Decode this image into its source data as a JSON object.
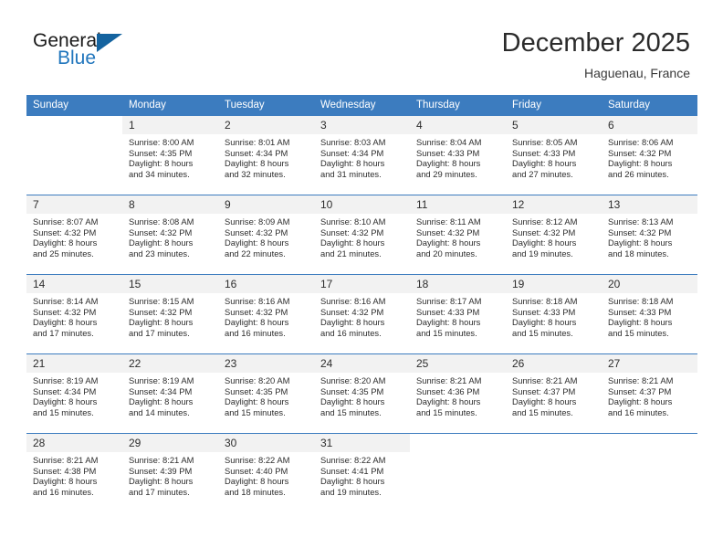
{
  "brand": {
    "name_part1": "General",
    "name_part2": "Blue",
    "logo_icon": "triangle-logo-icon"
  },
  "header": {
    "month_title": "December 2025",
    "location": "Haguenau, France",
    "accent_color": "#3c7cbf",
    "brand_blue": "#2176bd"
  },
  "calendar": {
    "weekday_headers": [
      "Sunday",
      "Monday",
      "Tuesday",
      "Wednesday",
      "Thursday",
      "Friday",
      "Saturday"
    ],
    "weeks": [
      [
        {
          "blank": true
        },
        {
          "day": "1",
          "sunrise": "Sunrise: 8:00 AM",
          "sunset": "Sunset: 4:35 PM",
          "daylight1": "Daylight: 8 hours",
          "daylight2": "and 34 minutes."
        },
        {
          "day": "2",
          "sunrise": "Sunrise: 8:01 AM",
          "sunset": "Sunset: 4:34 PM",
          "daylight1": "Daylight: 8 hours",
          "daylight2": "and 32 minutes."
        },
        {
          "day": "3",
          "sunrise": "Sunrise: 8:03 AM",
          "sunset": "Sunset: 4:34 PM",
          "daylight1": "Daylight: 8 hours",
          "daylight2": "and 31 minutes."
        },
        {
          "day": "4",
          "sunrise": "Sunrise: 8:04 AM",
          "sunset": "Sunset: 4:33 PM",
          "daylight1": "Daylight: 8 hours",
          "daylight2": "and 29 minutes."
        },
        {
          "day": "5",
          "sunrise": "Sunrise: 8:05 AM",
          "sunset": "Sunset: 4:33 PM",
          "daylight1": "Daylight: 8 hours",
          "daylight2": "and 27 minutes."
        },
        {
          "day": "6",
          "sunrise": "Sunrise: 8:06 AM",
          "sunset": "Sunset: 4:32 PM",
          "daylight1": "Daylight: 8 hours",
          "daylight2": "and 26 minutes."
        }
      ],
      [
        {
          "day": "7",
          "sunrise": "Sunrise: 8:07 AM",
          "sunset": "Sunset: 4:32 PM",
          "daylight1": "Daylight: 8 hours",
          "daylight2": "and 25 minutes."
        },
        {
          "day": "8",
          "sunrise": "Sunrise: 8:08 AM",
          "sunset": "Sunset: 4:32 PM",
          "daylight1": "Daylight: 8 hours",
          "daylight2": "and 23 minutes."
        },
        {
          "day": "9",
          "sunrise": "Sunrise: 8:09 AM",
          "sunset": "Sunset: 4:32 PM",
          "daylight1": "Daylight: 8 hours",
          "daylight2": "and 22 minutes."
        },
        {
          "day": "10",
          "sunrise": "Sunrise: 8:10 AM",
          "sunset": "Sunset: 4:32 PM",
          "daylight1": "Daylight: 8 hours",
          "daylight2": "and 21 minutes."
        },
        {
          "day": "11",
          "sunrise": "Sunrise: 8:11 AM",
          "sunset": "Sunset: 4:32 PM",
          "daylight1": "Daylight: 8 hours",
          "daylight2": "and 20 minutes."
        },
        {
          "day": "12",
          "sunrise": "Sunrise: 8:12 AM",
          "sunset": "Sunset: 4:32 PM",
          "daylight1": "Daylight: 8 hours",
          "daylight2": "and 19 minutes."
        },
        {
          "day": "13",
          "sunrise": "Sunrise: 8:13 AM",
          "sunset": "Sunset: 4:32 PM",
          "daylight1": "Daylight: 8 hours",
          "daylight2": "and 18 minutes."
        }
      ],
      [
        {
          "day": "14",
          "sunrise": "Sunrise: 8:14 AM",
          "sunset": "Sunset: 4:32 PM",
          "daylight1": "Daylight: 8 hours",
          "daylight2": "and 17 minutes."
        },
        {
          "day": "15",
          "sunrise": "Sunrise: 8:15 AM",
          "sunset": "Sunset: 4:32 PM",
          "daylight1": "Daylight: 8 hours",
          "daylight2": "and 17 minutes."
        },
        {
          "day": "16",
          "sunrise": "Sunrise: 8:16 AM",
          "sunset": "Sunset: 4:32 PM",
          "daylight1": "Daylight: 8 hours",
          "daylight2": "and 16 minutes."
        },
        {
          "day": "17",
          "sunrise": "Sunrise: 8:16 AM",
          "sunset": "Sunset: 4:32 PM",
          "daylight1": "Daylight: 8 hours",
          "daylight2": "and 16 minutes."
        },
        {
          "day": "18",
          "sunrise": "Sunrise: 8:17 AM",
          "sunset": "Sunset: 4:33 PM",
          "daylight1": "Daylight: 8 hours",
          "daylight2": "and 15 minutes."
        },
        {
          "day": "19",
          "sunrise": "Sunrise: 8:18 AM",
          "sunset": "Sunset: 4:33 PM",
          "daylight1": "Daylight: 8 hours",
          "daylight2": "and 15 minutes."
        },
        {
          "day": "20",
          "sunrise": "Sunrise: 8:18 AM",
          "sunset": "Sunset: 4:33 PM",
          "daylight1": "Daylight: 8 hours",
          "daylight2": "and 15 minutes."
        }
      ],
      [
        {
          "day": "21",
          "sunrise": "Sunrise: 8:19 AM",
          "sunset": "Sunset: 4:34 PM",
          "daylight1": "Daylight: 8 hours",
          "daylight2": "and 15 minutes."
        },
        {
          "day": "22",
          "sunrise": "Sunrise: 8:19 AM",
          "sunset": "Sunset: 4:34 PM",
          "daylight1": "Daylight: 8 hours",
          "daylight2": "and 14 minutes."
        },
        {
          "day": "23",
          "sunrise": "Sunrise: 8:20 AM",
          "sunset": "Sunset: 4:35 PM",
          "daylight1": "Daylight: 8 hours",
          "daylight2": "and 15 minutes."
        },
        {
          "day": "24",
          "sunrise": "Sunrise: 8:20 AM",
          "sunset": "Sunset: 4:35 PM",
          "daylight1": "Daylight: 8 hours",
          "daylight2": "and 15 minutes."
        },
        {
          "day": "25",
          "sunrise": "Sunrise: 8:21 AM",
          "sunset": "Sunset: 4:36 PM",
          "daylight1": "Daylight: 8 hours",
          "daylight2": "and 15 minutes."
        },
        {
          "day": "26",
          "sunrise": "Sunrise: 8:21 AM",
          "sunset": "Sunset: 4:37 PM",
          "daylight1": "Daylight: 8 hours",
          "daylight2": "and 15 minutes."
        },
        {
          "day": "27",
          "sunrise": "Sunrise: 8:21 AM",
          "sunset": "Sunset: 4:37 PM",
          "daylight1": "Daylight: 8 hours",
          "daylight2": "and 16 minutes."
        }
      ],
      [
        {
          "day": "28",
          "sunrise": "Sunrise: 8:21 AM",
          "sunset": "Sunset: 4:38 PM",
          "daylight1": "Daylight: 8 hours",
          "daylight2": "and 16 minutes."
        },
        {
          "day": "29",
          "sunrise": "Sunrise: 8:21 AM",
          "sunset": "Sunset: 4:39 PM",
          "daylight1": "Daylight: 8 hours",
          "daylight2": "and 17 minutes."
        },
        {
          "day": "30",
          "sunrise": "Sunrise: 8:22 AM",
          "sunset": "Sunset: 4:40 PM",
          "daylight1": "Daylight: 8 hours",
          "daylight2": "and 18 minutes."
        },
        {
          "day": "31",
          "sunrise": "Sunrise: 8:22 AM",
          "sunset": "Sunset: 4:41 PM",
          "daylight1": "Daylight: 8 hours",
          "daylight2": "and 19 minutes."
        },
        {
          "blank": true
        },
        {
          "blank": true
        },
        {
          "blank": true
        }
      ]
    ]
  }
}
